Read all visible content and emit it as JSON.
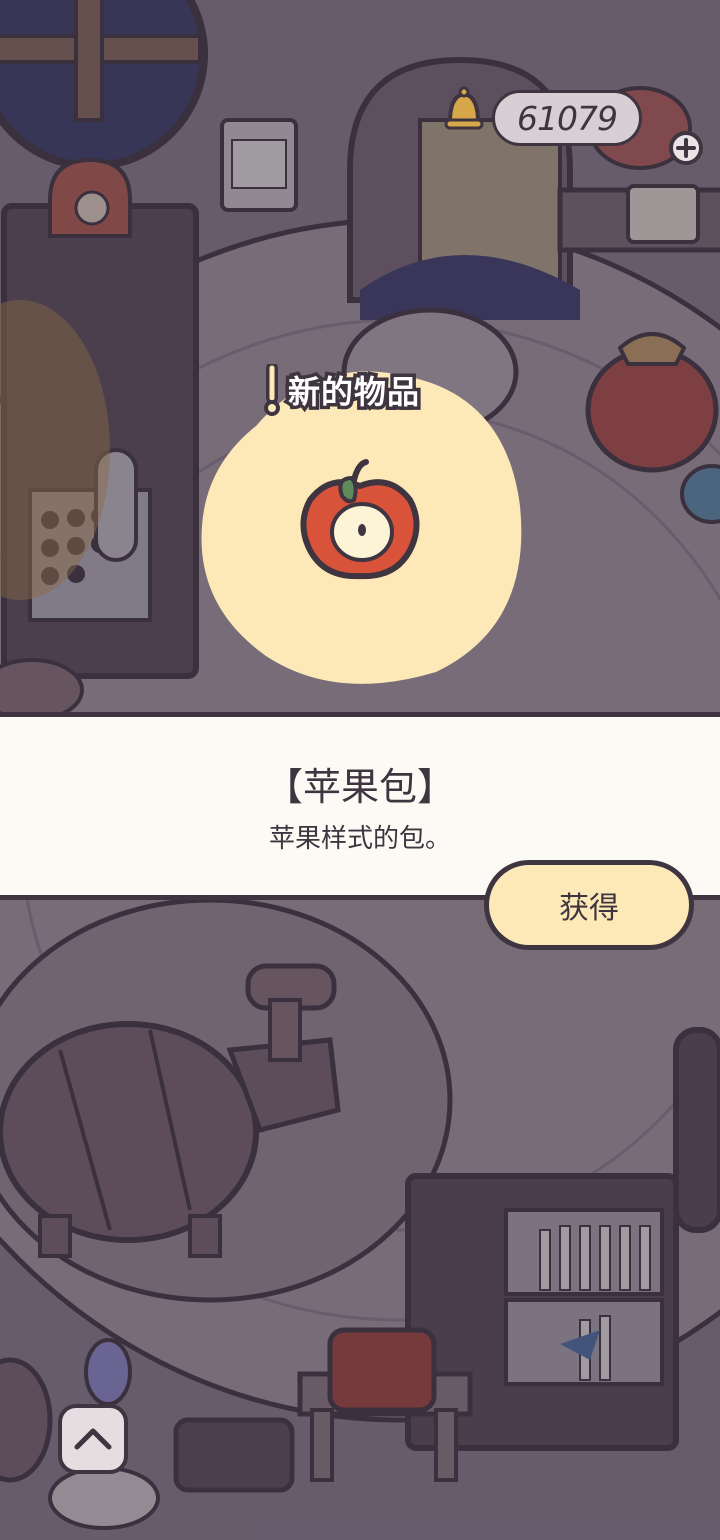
{
  "currency": {
    "amount": "61079",
    "icon": "bell-icon",
    "add_icon": "plus-icon"
  },
  "new_item": {
    "label": "新的物品",
    "icon": "apple-bag-icon"
  },
  "item": {
    "title": "【苹果包】",
    "description": "苹果样式的包。"
  },
  "actions": {
    "obtain_label": "获得"
  },
  "nav": {
    "expand_icon": "chevron-up-icon"
  },
  "colors": {
    "outline": "#3e3540",
    "highlight": "#fde9b7",
    "banner": "#fcfaf4",
    "apple_red": "#d9533a"
  }
}
